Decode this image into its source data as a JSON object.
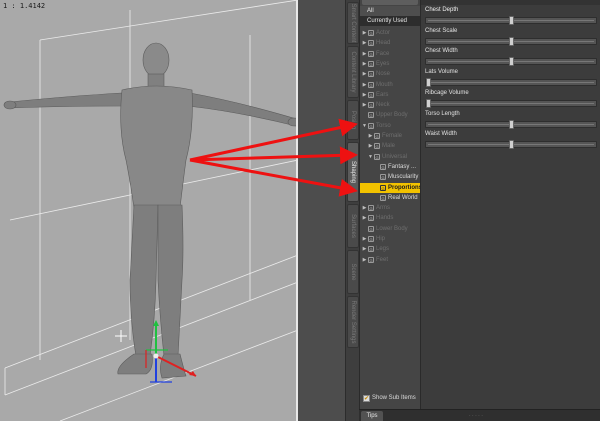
{
  "viewport": {
    "label": "1 : 1.4142"
  },
  "vertical_tabs": [
    {
      "label": "Smart Content"
    },
    {
      "label": "Content Library"
    },
    {
      "label": "Posing"
    },
    {
      "label": "Shaping"
    },
    {
      "label": "Surfaces"
    },
    {
      "label": "Scene"
    },
    {
      "label": "Render Settings"
    }
  ],
  "categories": {
    "all": "All",
    "currently_used": "Currently Used",
    "items": [
      {
        "label": "Actor",
        "arrow": "▶",
        "level": 0,
        "state": "dim"
      },
      {
        "label": "Head",
        "arrow": "▶",
        "level": 0,
        "state": "dim"
      },
      {
        "label": "Face",
        "arrow": "▶",
        "level": 0,
        "state": "dim"
      },
      {
        "label": "Eyes",
        "arrow": "▶",
        "level": 0,
        "state": "dim"
      },
      {
        "label": "Nose",
        "arrow": "▶",
        "level": 0,
        "state": "dim"
      },
      {
        "label": "Mouth",
        "arrow": "▶",
        "level": 0,
        "state": "dim"
      },
      {
        "label": "Ears",
        "arrow": "▶",
        "level": 0,
        "state": "dim"
      },
      {
        "label": "Neck",
        "arrow": "▶",
        "level": 0,
        "state": "dim"
      },
      {
        "label": "Upper Body",
        "arrow": "",
        "level": 0,
        "state": "dim"
      },
      {
        "label": "Torso",
        "arrow": "▼",
        "level": 0,
        "state": "dim"
      },
      {
        "label": "Female",
        "arrow": "▶",
        "level": 1,
        "state": "dim"
      },
      {
        "label": "Male",
        "arrow": "▶",
        "level": 1,
        "state": "dim"
      },
      {
        "label": "Universal",
        "arrow": "▼",
        "level": 1,
        "state": "dim"
      },
      {
        "label": "Fantasy ...",
        "arrow": "",
        "level": 2,
        "state": "norm"
      },
      {
        "label": "Muscularity",
        "arrow": "",
        "level": 2,
        "state": "norm"
      },
      {
        "label": "Proportions",
        "arrow": "",
        "level": 2,
        "state": "sel"
      },
      {
        "label": "Real World",
        "arrow": "",
        "level": 2,
        "state": "norm"
      },
      {
        "label": "Arms",
        "arrow": "▶",
        "level": 0,
        "state": "dim"
      },
      {
        "label": "Hands",
        "arrow": "▶",
        "level": 0,
        "state": "dim"
      },
      {
        "label": "Lower Body",
        "arrow": "",
        "level": 0,
        "state": "dim"
      },
      {
        "label": "Hip",
        "arrow": "▶",
        "level": 0,
        "state": "dim"
      },
      {
        "label": "Legs",
        "arrow": "▶",
        "level": 0,
        "state": "dim"
      },
      {
        "label": "Feet",
        "arrow": "▶",
        "level": 0,
        "state": "dim"
      }
    ],
    "node_glyph": "G",
    "show_sub_items": "Show Sub Items",
    "show_sub_checked": true
  },
  "sliders": [
    {
      "name": "Chest Depth",
      "value": 0.5
    },
    {
      "name": "Chest Scale",
      "value": 0.5
    },
    {
      "name": "Chest Width",
      "value": 0.5
    },
    {
      "name": "Lats Volume",
      "value": 0.0
    },
    {
      "name": "Ribcage Volume",
      "value": 0.0
    },
    {
      "name": "Torso Length",
      "value": 0.5
    },
    {
      "name": "Waist Width",
      "value": 0.5
    }
  ],
  "bottom": {
    "tips_tab": "Tips"
  },
  "colors": {
    "selection": "#f2c200",
    "annotation_arrow": "#ee1111",
    "axis_x": "#e02020",
    "axis_y": "#20c040",
    "axis_z": "#2040e0"
  },
  "icons": {
    "tree_node": "group-node-icon",
    "checkbox": "checkmark-icon",
    "manipulator": "universal-manipulator-icon"
  }
}
